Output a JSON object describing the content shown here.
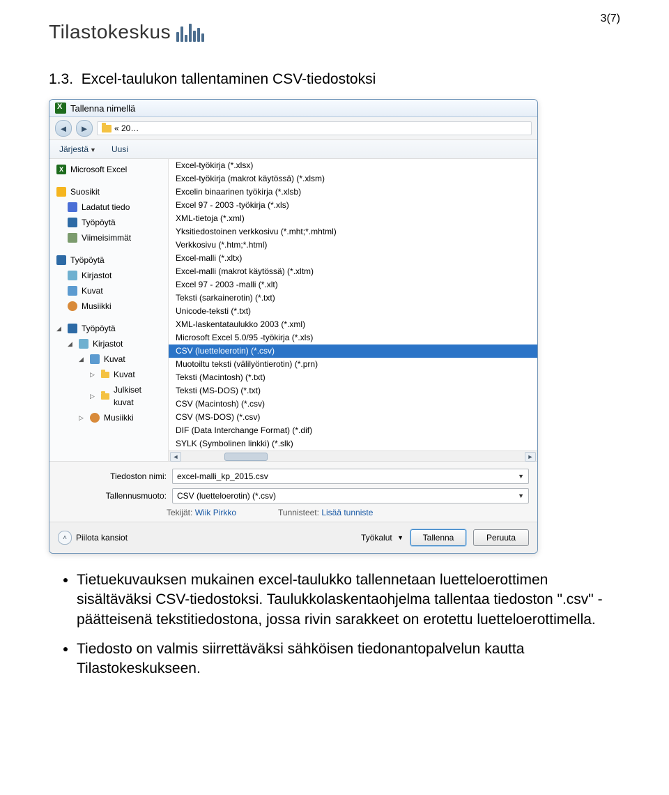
{
  "page_number": "3(7)",
  "logo_text": "Tilastokeskus",
  "section_number": "1.3.",
  "section_title": "Excel-taulukon tallentaminen CSV-tiedostoksi",
  "dialog": {
    "title": "Tallenna nimellä",
    "breadcrumb": "« 20…",
    "toolbar": {
      "jarjesta": "Järjestä",
      "uusi": "Uusi"
    },
    "side_items": {
      "excel": "Microsoft Excel",
      "suosikit": "Suosikit",
      "ladatut": "Ladatut tiedo",
      "tyopoyta": "Työpöytä",
      "viimeisimmat": "Viimeisimmät",
      "tyopoyta2": "Työpöytä",
      "kirjastot": "Kirjastot",
      "kuvat": "Kuvat",
      "musiikki": "Musiikki",
      "tyopoyta_tree": "Työpöytä",
      "kirjastot_tree": "Kirjastot",
      "kuvat_tree": "Kuvat",
      "kuvat_tree2": "Kuvat",
      "julkiset_kuvat": "Julkiset kuvat",
      "musiikki_tree": "Musiikki"
    },
    "formats": [
      "Excel-työkirja (*.xlsx)",
      "Excel-työkirja (makrot käytössä) (*.xlsm)",
      "Excelin binaarinen työkirja (*.xlsb)",
      "Excel 97 - 2003 -työkirja (*.xls)",
      "XML-tietoja (*.xml)",
      "Yksitiedostoinen verkkosivu (*.mht;*.mhtml)",
      "Verkkosivu (*.htm;*.html)",
      "Excel-malli (*.xltx)",
      "Excel-malli (makrot käytössä) (*.xltm)",
      "Excel 97 - 2003 -malli (*.xlt)",
      "Teksti (sarkainerotin) (*.txt)",
      "Unicode-teksti (*.txt)",
      "XML-laskentataulukko 2003 (*.xml)",
      "Microsoft Excel 5.0/95 -työkirja (*.xls)",
      "CSV (luetteloerotin) (*.csv)",
      "Muotoiltu teksti (välilyöntierotin) (*.prn)",
      "Teksti (Macintosh) (*.txt)",
      "Teksti (MS-DOS) (*.txt)",
      "CSV (Macintosh) (*.csv)",
      "CSV (MS-DOS) (*.csv)",
      "DIF (Data Interchange Format) (*.dif)",
      "SYLK (Symbolinen linkki) (*.slk)"
    ],
    "fields": {
      "file_label": "Tiedoston nimi:",
      "file_value": "excel-malli_kp_2015.csv",
      "type_label": "Tallennusmuoto:",
      "type_value": "CSV (luetteloerotin) (*.csv)",
      "author_label": "Tekijät:",
      "author_value": "Wiik Pirkko",
      "tags_label": "Tunnisteet:",
      "tags_value": "Lisää tunniste"
    },
    "footer": {
      "hide_folders": "Piilota kansiot",
      "tools": "Työkalut",
      "save": "Tallenna",
      "cancel": "Peruuta"
    }
  },
  "bullets": {
    "b1": "Tietuekuvauksen mukainen excel-taulukko tallennetaan luetteloerottimen sisältäväksi CSV-tiedostoksi. Taulukkolaskentaohjelma tallentaa tiedoston \".csv\" -päätteisenä tekstitiedostona, jossa rivin sarakkeet on erotettu luetteloerottimella.",
    "b2": "Tiedosto on valmis siirrettäväksi sähköisen tiedonantopalvelun kautta Tilastokeskukseen."
  }
}
